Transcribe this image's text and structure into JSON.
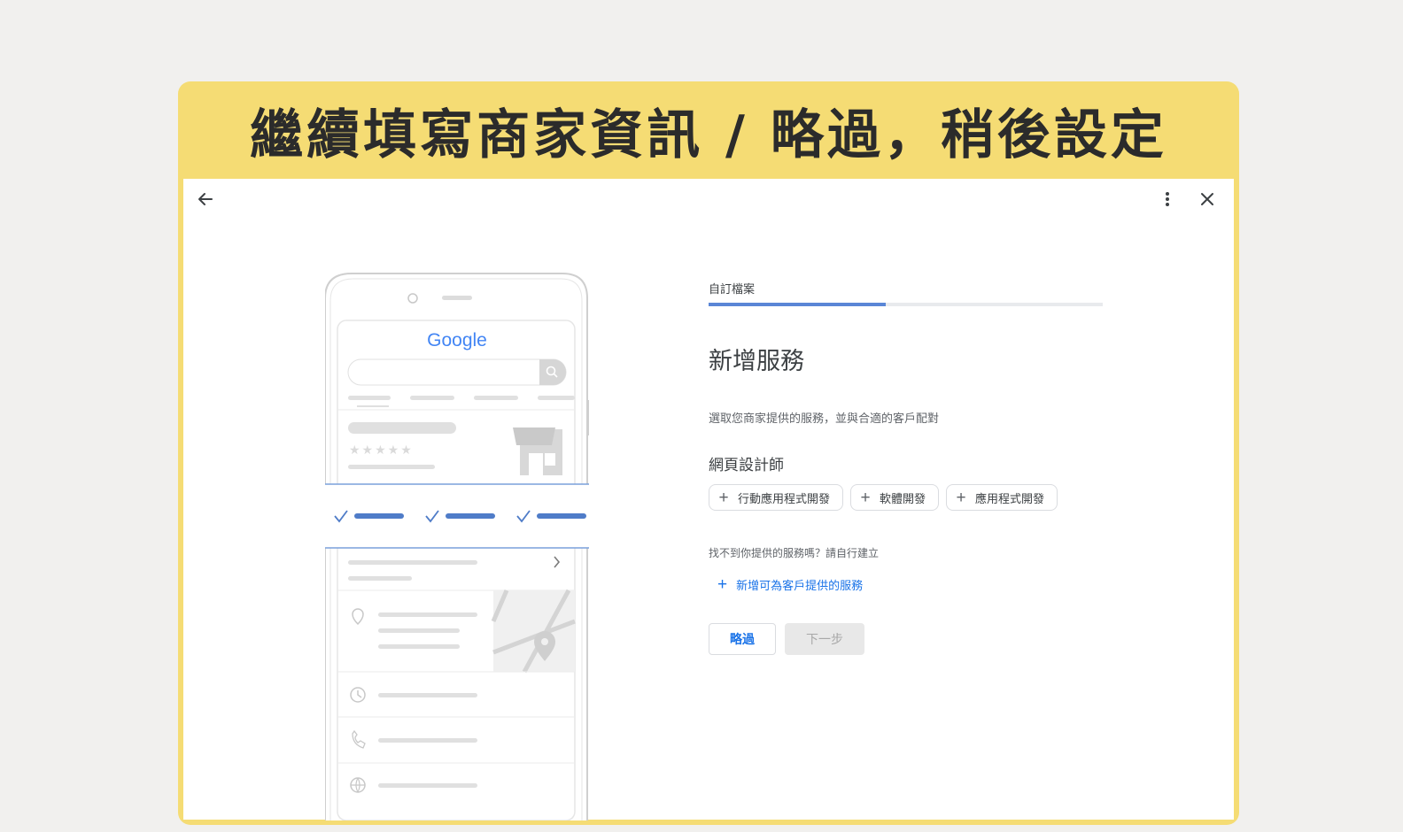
{
  "banner": {
    "title": "繼續填寫商家資訊 / 略過，稍後設定"
  },
  "toolbar": {
    "back_icon": "arrow-left-icon",
    "more_icon": "more-vert-icon",
    "close_icon": "close-icon"
  },
  "illustration": {
    "logo_text": "Google",
    "rating_stars": "★★★★★"
  },
  "form": {
    "step_label": "自訂檔案",
    "progress": 0.45,
    "heading": "新增服務",
    "subtitle": "選取您商家提供的服務，並與合適的客戶配對",
    "category": "網頁設計師",
    "chips": [
      {
        "label": "行動應用程式開發"
      },
      {
        "label": "軟體開發"
      },
      {
        "label": "應用程式開發"
      }
    ],
    "helper": "找不到你提供的服務嗎？請自行建立",
    "add_link": "新增可為客戶提供的服務",
    "skip_label": "略過",
    "next_label": "下一步"
  },
  "colors": {
    "banner": "#f5dc74",
    "accent": "#1a73e8",
    "progress": "#5a86d6"
  }
}
